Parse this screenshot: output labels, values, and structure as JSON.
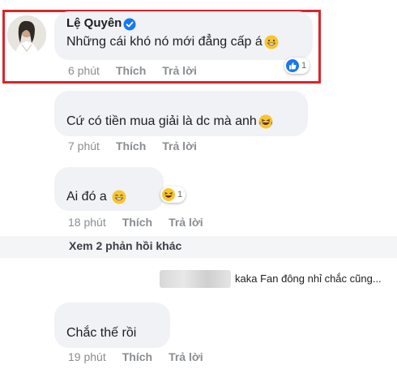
{
  "comments": [
    {
      "author": "Lệ Quyên",
      "text": "Những cái khó nó mới đẳng cấp á",
      "time": "6 phút",
      "like_label": "Thích",
      "reply_label": "Trả lời",
      "reaction": {
        "type": "like",
        "count": "1"
      }
    },
    {
      "text": "Cứ có tiền mua giải là dc mà anh",
      "time": "7 phút",
      "like_label": "Thích",
      "reply_label": "Trả lời"
    },
    {
      "text": "Ai đó a",
      "time": "18 phút",
      "like_label": "Thích",
      "reply_label": "Trả lời",
      "reaction": {
        "type": "haha",
        "count": "1"
      }
    },
    {
      "text": "Chắc thế rồi",
      "time": "19 phút",
      "like_label": "Thích",
      "reply_label": "Trả lời"
    }
  ],
  "more_replies_label": "Xem 2 phản hồi khác",
  "reply_preview": "kaka Fan đông nhỉ chắc cũng...",
  "colors": {
    "highlight": "#d9262b",
    "like_blue": "#1877f2",
    "verified_blue": "#1877f2",
    "bubble": "#f0f2f5"
  }
}
